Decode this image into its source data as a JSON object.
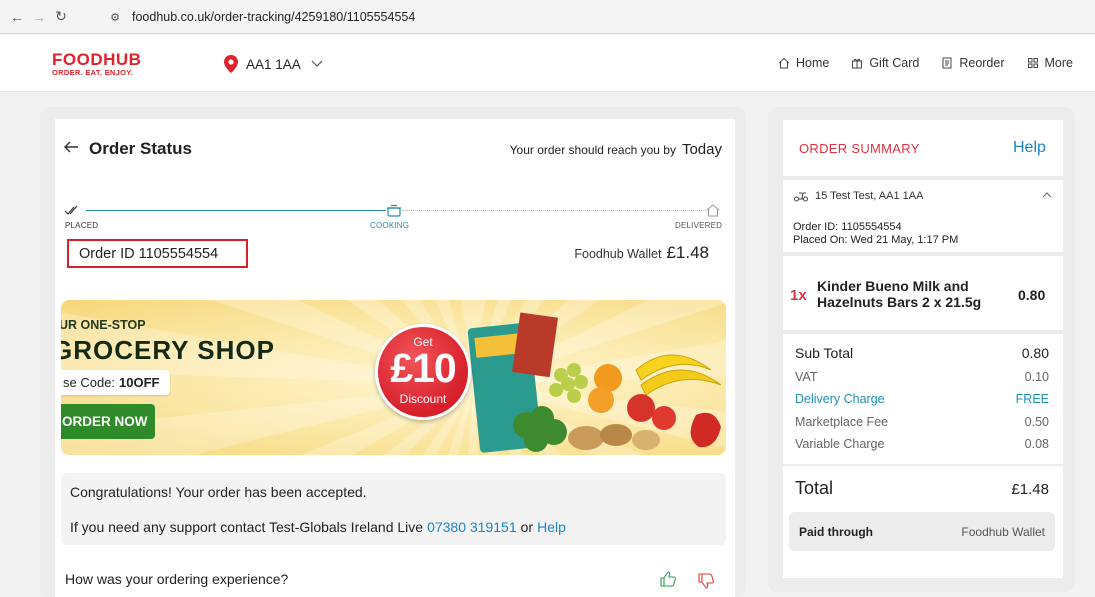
{
  "browser": {
    "url": "foodhub.co.uk/order-tracking/4259180/1105554554"
  },
  "header": {
    "logo_main": "FOODHUB",
    "logo_tagline": "ORDER. EAT. ENJOY.",
    "postcode": "AA1 1AA",
    "nav": [
      {
        "label": "Home",
        "icon": "home-icon"
      },
      {
        "label": "Gift Card",
        "icon": "gift-icon"
      },
      {
        "label": "Reorder",
        "icon": "receipt-icon"
      },
      {
        "label": "More",
        "icon": "grid-icon"
      }
    ]
  },
  "order_status": {
    "title": "Order Status",
    "eta_text": "Your order should reach you by",
    "eta_time": "Today",
    "steps": [
      {
        "label": "PLACED",
        "state": "done"
      },
      {
        "label": "COOKING",
        "state": "active"
      },
      {
        "label": "DELIVERED",
        "state": "pending"
      }
    ],
    "order_id": "Order ID 1105554554",
    "wallet_label": "Foodhub Wallet",
    "wallet_amount": "£1.48"
  },
  "banner": {
    "line1": "UR ONE-STOP",
    "line2": "GROCERY SHOP",
    "code_prefix": "se Code:",
    "code": "10OFF",
    "cta": "ORDER NOW",
    "badge_get": "Get",
    "badge_amount": "£10",
    "badge_discount": "Discount"
  },
  "messages": {
    "accepted": "Congratulations! Your order has been accepted.",
    "support_prefix": "If you need any support contact Test-Globals Ireland Live",
    "phone": "07380  319151",
    "or": "or",
    "help": "Help",
    "feedback_question": "How was your ordering experience?"
  },
  "summary": {
    "title": "ORDER SUMMARY",
    "help": "Help",
    "address": "15 Test Test, AA1 1AA",
    "order_id_line": "Order ID:  1105554554",
    "placed_on_line": "Placed On: Wed 21 May, 1:17 PM",
    "item": {
      "qty": "1x",
      "name": "Kinder Bueno Milk and Hazelnuts Bars 2 x 21.5g",
      "price": "0.80"
    },
    "subtotal": {
      "label": "Sub Total",
      "value": "0.80"
    },
    "vat": {
      "label": "VAT",
      "value": "0.10"
    },
    "delivery": {
      "label": "Delivery Charge",
      "value": "FREE"
    },
    "marketplace": {
      "label": "Marketplace Fee",
      "value": "0.50"
    },
    "variable": {
      "label": "Variable Charge",
      "value": "0.08"
    },
    "total": {
      "label": "Total",
      "value": "£1.48"
    },
    "paid_label": "Paid through",
    "paid_value": "Foodhub Wallet"
  },
  "colors": {
    "brand_red": "#e0232b",
    "link_blue": "#1a86c7",
    "tracker_teal": "#2a8aa0",
    "delivery_teal": "#1d93b2"
  }
}
